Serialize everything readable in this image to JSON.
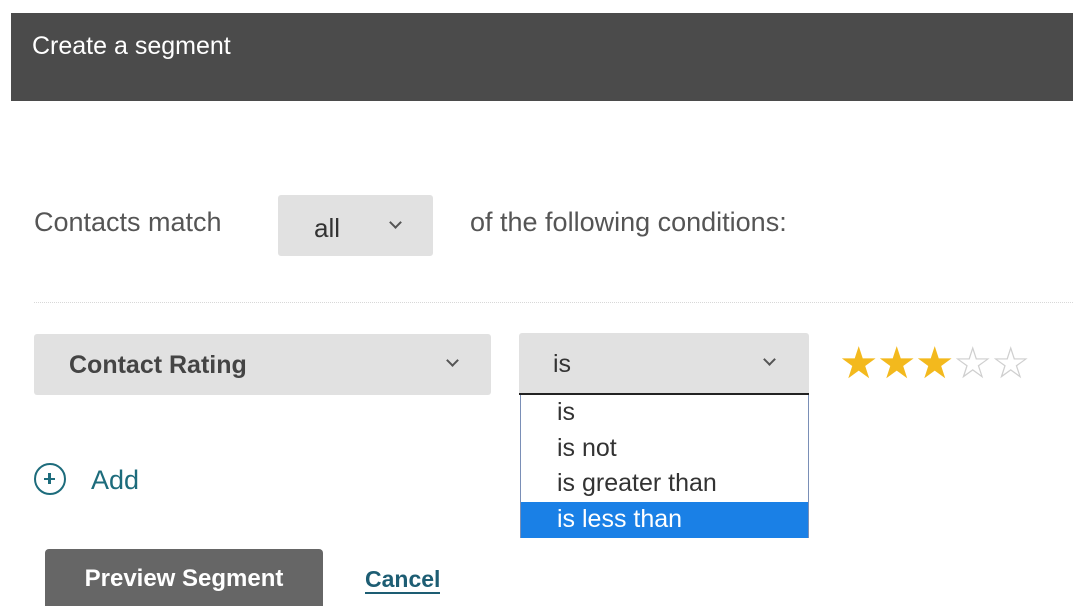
{
  "header": {
    "title": "Create a segment"
  },
  "match": {
    "label": "Contacts match",
    "selected": "all",
    "suffix": "of the following conditions:"
  },
  "condition": {
    "field": "Contact Rating",
    "operator": "is",
    "operator_options": [
      "is",
      "is not",
      "is greater than",
      "is less than"
    ],
    "highlighted_option": "is less than",
    "rating_value": 3,
    "rating_max": 5
  },
  "actions": {
    "add_label": "Add",
    "preview_label": "Preview Segment",
    "cancel_label": "Cancel"
  },
  "icons": {
    "add": "plus-circle-icon",
    "dropdown": "chevron-down-icon",
    "star": "star-icon"
  },
  "colors": {
    "header_bg": "#4b4b4b",
    "select_bg": "#e1e1e1",
    "accent_teal": "#1d6c7c",
    "highlight_blue": "#1a80e6",
    "star_filled": "#f3b91d",
    "star_empty": "#cfcfcf",
    "preview_button_bg": "#666666"
  }
}
